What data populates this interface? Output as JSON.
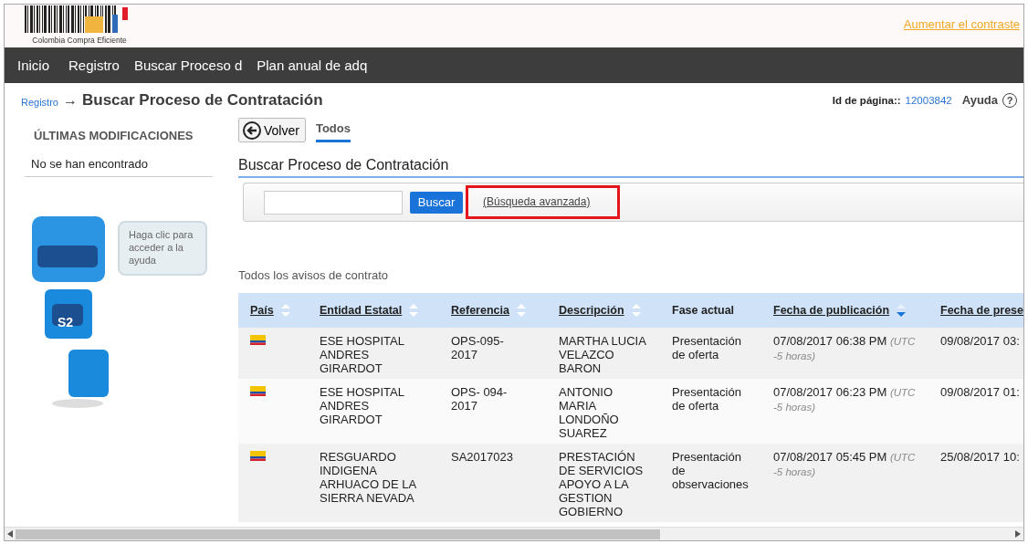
{
  "header": {
    "logo_text": "Colombia Compra Eficiente",
    "contrast_link": "Aumentar el contraste"
  },
  "nav": [
    "Inicio",
    "Registro",
    "Buscar Proceso d",
    "Plan anual de adq"
  ],
  "breadcrumb": {
    "parent": "Registro",
    "arrow": "→",
    "title": "Buscar Proceso de Contratación"
  },
  "page_id": {
    "label": "Id de página::",
    "value": "12003842"
  },
  "help": {
    "label": "Ayuda",
    "icon": "?"
  },
  "sidebar": {
    "title": "ÚLTIMAS MODIFICACIONES",
    "empty_text": "No se han encontrado",
    "mascot_badge": "S2",
    "bubble": "Haga clic para acceder a la ayuda"
  },
  "back_button": "Volver",
  "tabs": [
    {
      "label": "Todos",
      "selected": true
    }
  ],
  "section_title": "Buscar Proceso de Contratación",
  "search": {
    "button": "Buscar",
    "advanced_link": "(Búsqueda avanzada)",
    "highlighted": true
  },
  "list_title": "Todos los avisos de contrato",
  "table": {
    "columns": [
      {
        "label": "País",
        "sortable": true,
        "sorted_descending": false
      },
      {
        "label": "Entidad Estatal",
        "sortable": true,
        "sorted_descending": false
      },
      {
        "label": "Referencia",
        "sortable": true,
        "sorted_descending": false
      },
      {
        "label": "Descripción",
        "sortable": true,
        "sorted_descending": false
      },
      {
        "label": "Fase actual",
        "sortable": false,
        "sorted_descending": false
      },
      {
        "label": "Fecha de publicación",
        "sortable": true,
        "sorted_descending": true
      },
      {
        "label": "Fecha de prese"
      }
    ],
    "rows": [
      {
        "entity": "ESE HOSPITAL ANDRES GIRARDOT",
        "reference": "OPS-095-2017",
        "description": "MARTHA LUCIA VELAZCO BARON",
        "phase": "Presentación de oferta",
        "published": "07/08/2017 06:38 PM",
        "timezone": "(UTC -5 horas)",
        "deadline": "09/08/2017 03:"
      },
      {
        "entity": "ESE HOSPITAL ANDRES GIRARDOT",
        "reference": "OPS- 094-2017",
        "description": "ANTONIO MARIA LONDOÑO SUAREZ",
        "phase": "Presentación de oferta",
        "published": "07/08/2017 06:23 PM",
        "timezone": "(UTC -5 horas)",
        "deadline": "09/08/2017 01:"
      },
      {
        "entity": "RESGUARDO INDIGENA ARHUACO DE LA SIERRA NEVADA",
        "reference": "SA2017023",
        "description": "PRESTACIÓN DE SERVICIOS APOYO A LA GESTION GOBIERNO",
        "phase": "Presentación de observaciones",
        "published": "07/08/2017 05:45 PM",
        "timezone": "(UTC -5 horas)",
        "deadline": "25/08/2017 10:"
      }
    ]
  }
}
